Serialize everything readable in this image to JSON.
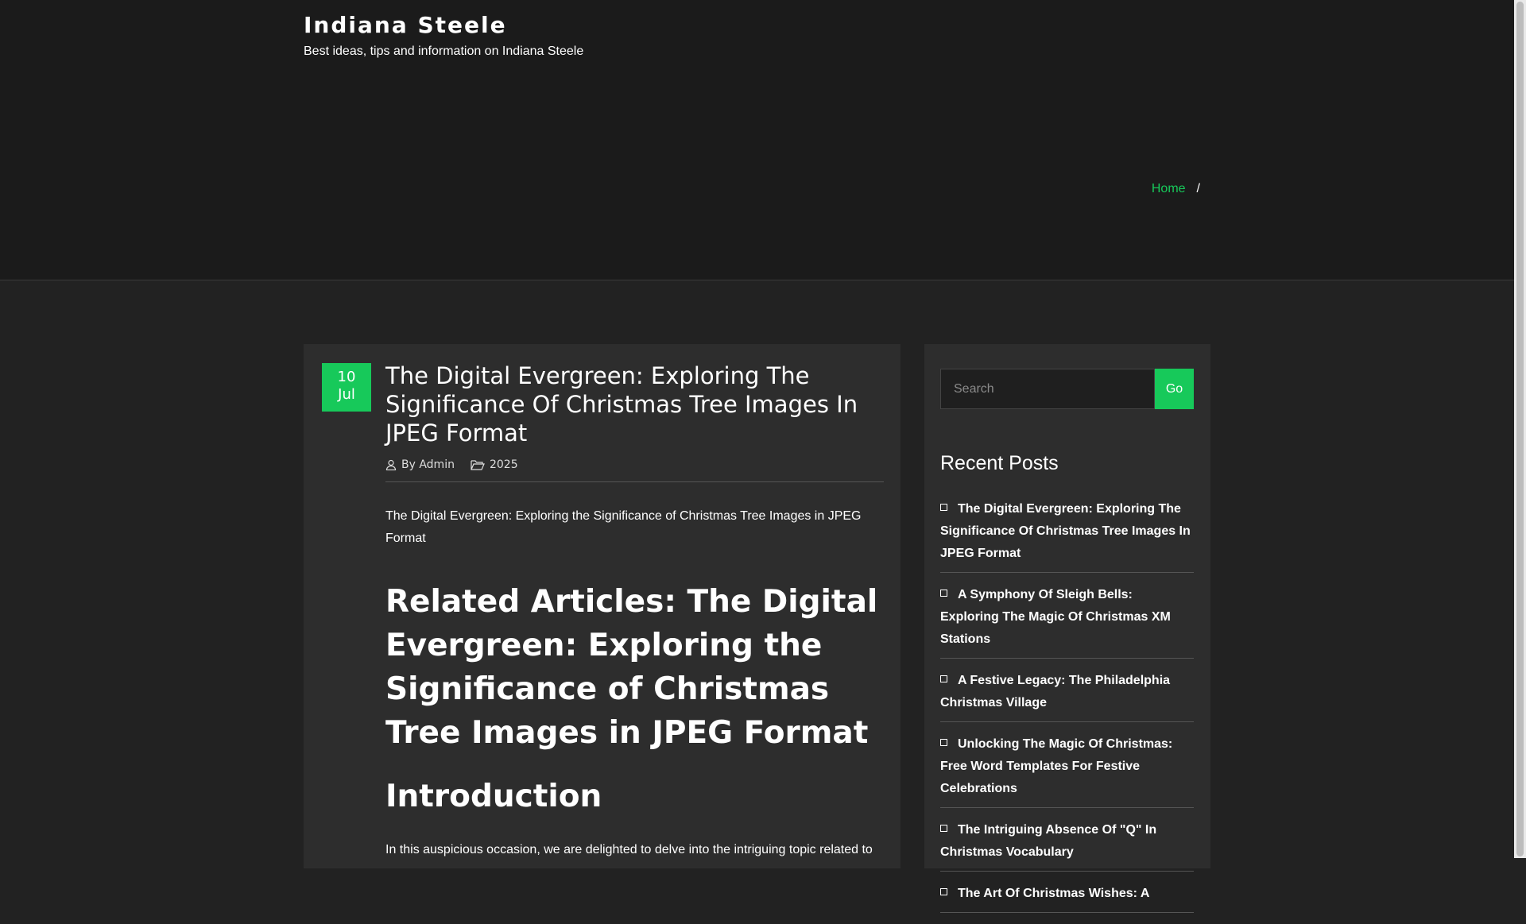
{
  "site": {
    "title": "Indiana Steele",
    "description": "Best ideas, tips and information on Indiana Steele"
  },
  "breadcrumb": {
    "home_label": "Home",
    "separator": "/"
  },
  "article": {
    "date_day": "10",
    "date_month": "Jul",
    "title": "The Digital Evergreen: Exploring The Significance Of Christmas Tree Images In JPEG Format",
    "author": "By Admin",
    "category": "2025",
    "intro": "The Digital Evergreen: Exploring the Significance of Christmas Tree Images in JPEG Format",
    "related_heading": "Related Articles: The Digital Evergreen: Exploring the Significance of Christmas Tree Images in JPEG Format",
    "intro_heading": "Introduction",
    "paragraph": "In this auspicious occasion, we are delighted to delve into the intriguing topic related to"
  },
  "sidebar": {
    "search_placeholder": "Search",
    "search_button": "Go",
    "recent_title": "Recent Posts",
    "recent_posts": [
      "The Digital Evergreen: Exploring The Significance Of Christmas Tree Images In JPEG Format",
      "A Symphony Of Sleigh Bells: Exploring The Magic Of Christmas XM Stations",
      "A Festive Legacy: The Philadelphia Christmas Village",
      "Unlocking The Magic Of Christmas: Free Word Templates For Festive Celebrations",
      "The Intriguing Absence Of \"Q\" In Christmas Vocabulary",
      "The Art Of Christmas Wishes: A"
    ]
  },
  "colors": {
    "accent": "#17c95a",
    "background": "#222222",
    "card": "#2d2d2d",
    "header": "#1b1b1b"
  }
}
